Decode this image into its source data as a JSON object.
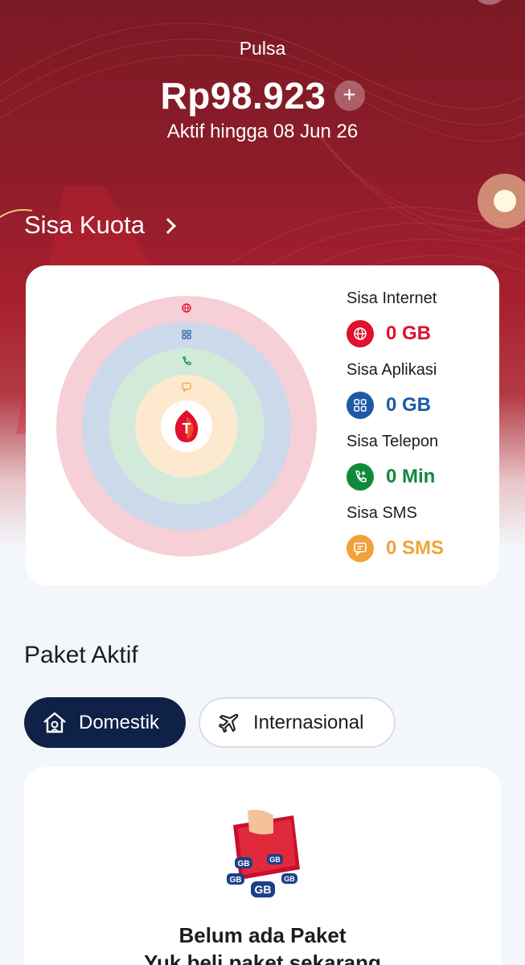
{
  "header": {
    "pulsa_label": "Pulsa",
    "balance": "Rp98.923",
    "add_symbol": "+",
    "active_until": "Aktif hingga 08 Jun 26"
  },
  "kuota": {
    "title": "Sisa Kuota",
    "items": [
      {
        "label": "Sisa Internet",
        "value": "0 GB",
        "icon": "globe-icon",
        "color": "#e0102e"
      },
      {
        "label": "Sisa Aplikasi",
        "value": "0 GB",
        "icon": "apps-icon",
        "color": "#1c5aa6"
      },
      {
        "label": "Sisa Telepon",
        "value": "0 Min",
        "icon": "phone-icon",
        "color": "#0f8a3c"
      },
      {
        "label": "Sisa SMS",
        "value": "0 SMS",
        "icon": "sms-icon",
        "color": "#f2a23a"
      }
    ]
  },
  "paket": {
    "title": "Paket Aktif",
    "tabs": [
      {
        "label": "Domestik",
        "icon": "house-icon",
        "selected": true
      },
      {
        "label": "Internasional",
        "icon": "airplane-icon",
        "selected": false
      }
    ],
    "empty_title": "Belum ada Paket",
    "empty_subtitle": "Yuk beli paket sekarang"
  },
  "colors": {
    "brand_red": "#a7202e",
    "navy": "#0f2147"
  }
}
